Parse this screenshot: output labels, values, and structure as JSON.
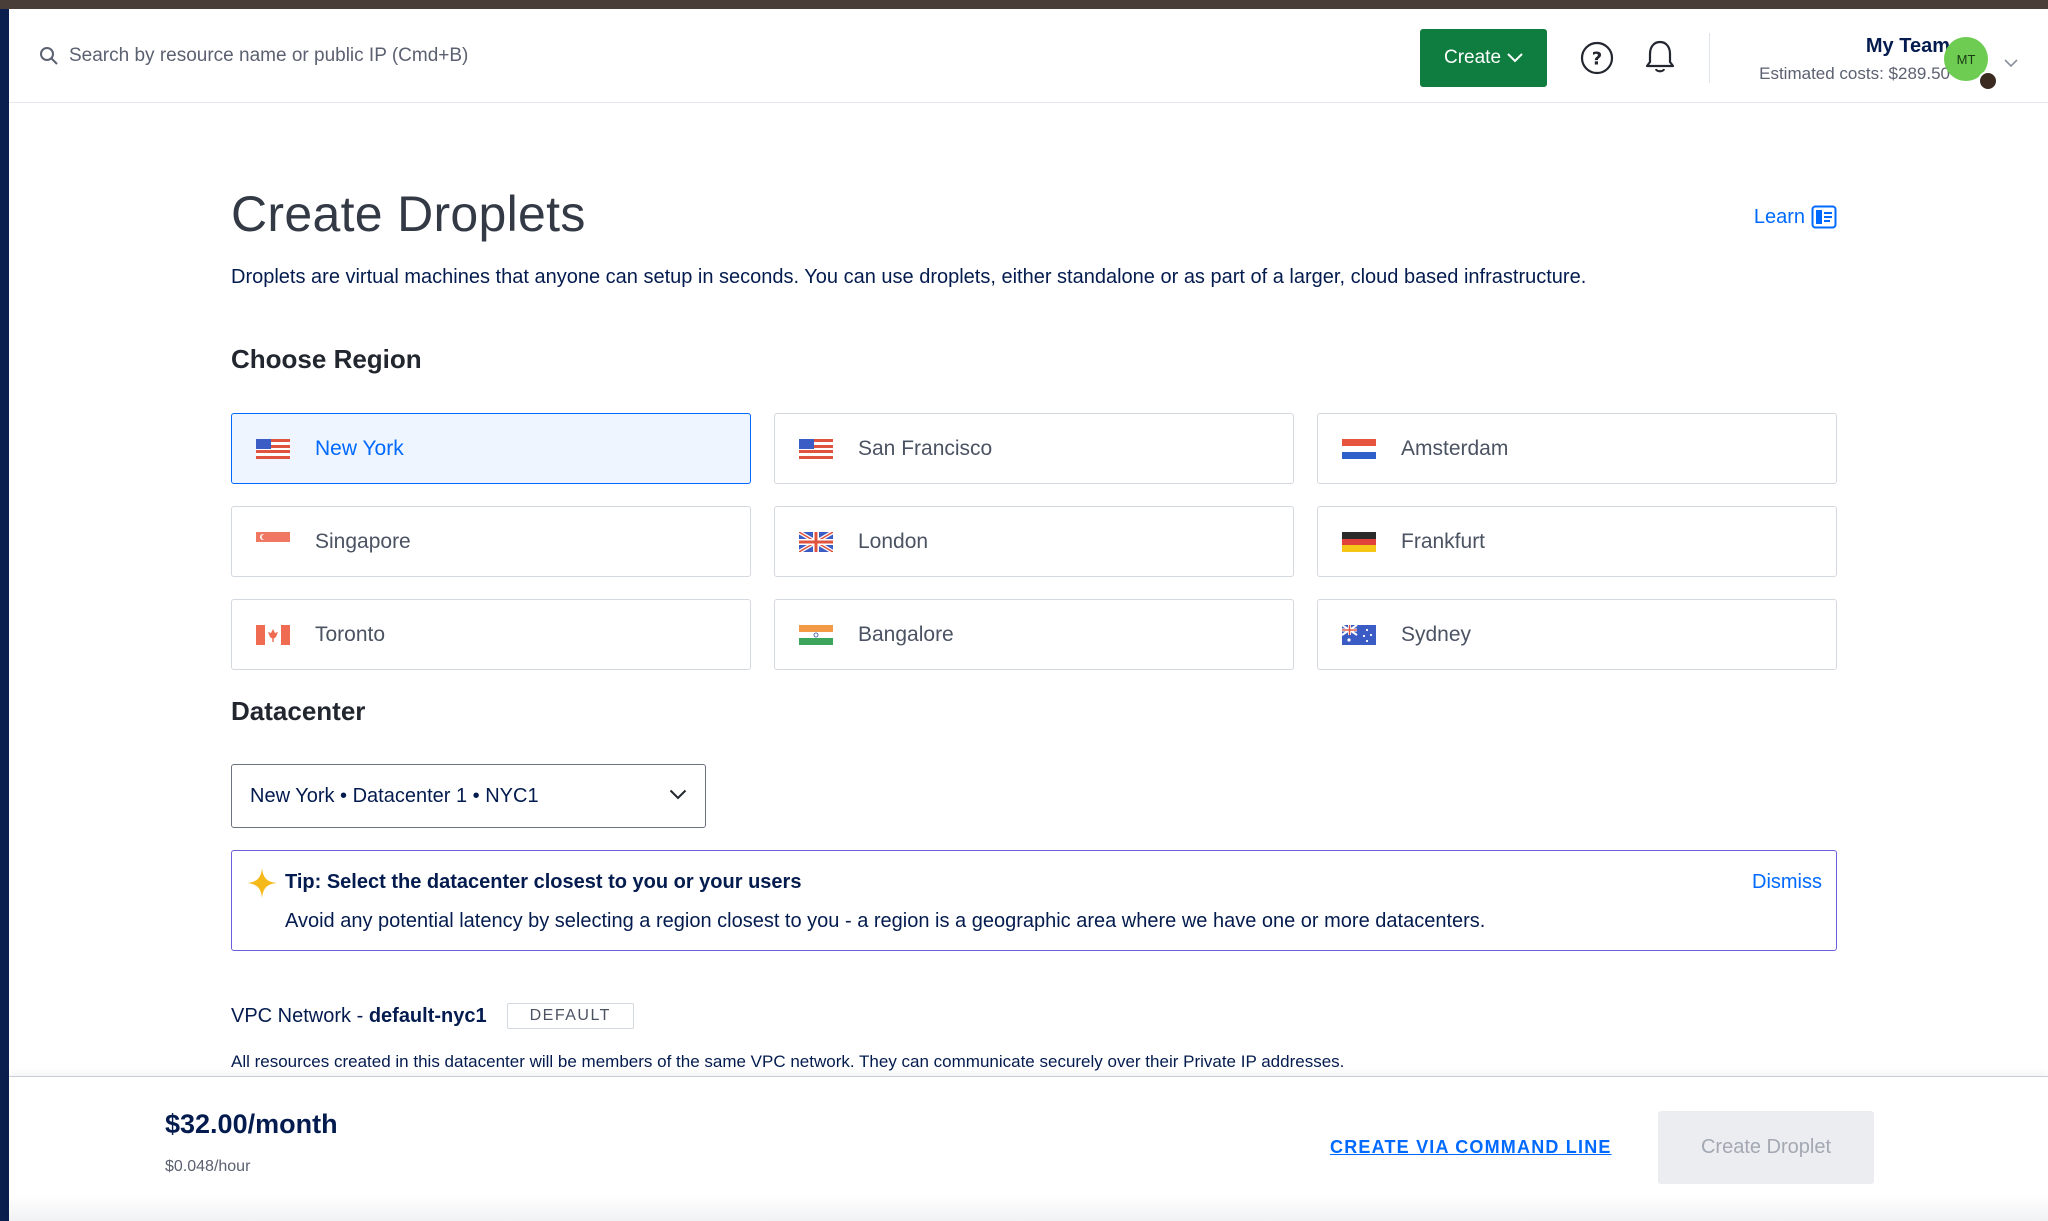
{
  "header": {
    "search_placeholder": "Search by resource name or public IP (Cmd+B)",
    "create_label": "Create",
    "team_name": "My Team",
    "estimated_costs": "Estimated costs: $289.50",
    "avatar_initials": "MT"
  },
  "page": {
    "title": "Create Droplets",
    "learn_label": "Learn",
    "intro": "Droplets are virtual machines that anyone can setup in seconds. You can use droplets, either standalone or as part of a larger, cloud based infrastructure."
  },
  "region": {
    "heading": "Choose Region",
    "selected": "New York",
    "items": [
      {
        "label": "New York",
        "flag": "us-flag-icon"
      },
      {
        "label": "San Francisco",
        "flag": "us-flag-icon"
      },
      {
        "label": "Amsterdam",
        "flag": "nl-flag-icon"
      },
      {
        "label": "Singapore",
        "flag": "sg-flag-icon"
      },
      {
        "label": "London",
        "flag": "uk-flag-icon"
      },
      {
        "label": "Frankfurt",
        "flag": "de-flag-icon"
      },
      {
        "label": "Toronto",
        "flag": "ca-flag-icon"
      },
      {
        "label": "Bangalore",
        "flag": "in-flag-icon"
      },
      {
        "label": "Sydney",
        "flag": "au-flag-icon"
      }
    ]
  },
  "datacenter": {
    "heading": "Datacenter",
    "selected": "New York • Datacenter 1 • NYC1"
  },
  "tip": {
    "title": "Tip: Select the datacenter closest to you or your users",
    "body": "Avoid any potential latency by selecting a region closest to you - a region is a geographic area where we have one or more datacenters.",
    "dismiss": "Dismiss"
  },
  "vpc": {
    "prefix": "VPC Network - ",
    "name": "default-nyc1",
    "badge": "DEFAULT",
    "note": "All resources created in this datacenter will be members of the same VPC network. They can communicate securely over their Private IP addresses."
  },
  "footer": {
    "price": "$32.00/month",
    "price_hour": "$0.048/hour",
    "cli_link": "CREATE VIA COMMAND LINE",
    "create_button": "Create Droplet"
  },
  "colors": {
    "accent": "#0069ff",
    "create_green": "#0f7d3f",
    "tip_border": "#6a5fd8",
    "avatar_green": "#6dcc51"
  }
}
